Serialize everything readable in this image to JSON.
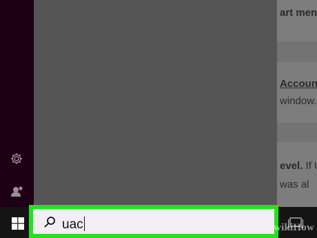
{
  "background_document": {
    "line1": "art men",
    "line2": "Account",
    "line3": "window.",
    "line4_bold": "evel.",
    "line4_rest": " If U",
    "line5": "was al"
  },
  "sidebar": {
    "settings_icon": "gear-icon",
    "user_icon": "user-icon"
  },
  "taskbar": {
    "start_icon": "windows-logo-icon",
    "search_value": "uac",
    "task_view_icon": "task-view-icon"
  },
  "watermark": "wikiHow",
  "colors": {
    "highlight": "#22e21f",
    "rail": "#1d0013",
    "panel": "#555555"
  }
}
